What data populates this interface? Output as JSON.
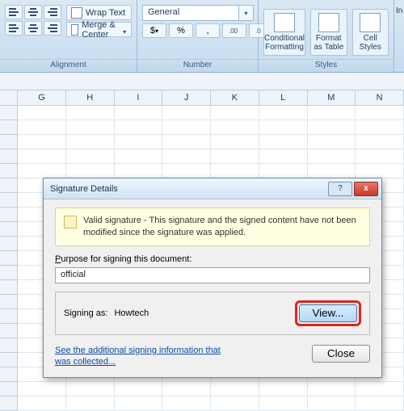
{
  "ribbon": {
    "alignment": {
      "title": "Alignment",
      "wrap_text": "Wrap Text",
      "merge_center": "Merge & Center"
    },
    "number": {
      "title": "Number",
      "format_selected": "General",
      "percent": "%",
      "currency": "$",
      "comma": ","
    },
    "styles": {
      "title": "Styles",
      "conditional": "Conditional Formatting",
      "format_as_table": "Format as Table",
      "cell_styles": "Cell Styles"
    },
    "insert_partial": "In"
  },
  "columns": [
    "G",
    "H",
    "I",
    "J",
    "K",
    "L",
    "M",
    "N"
  ],
  "dialog": {
    "title": "Signature Details",
    "valid_msg": "Valid signature - This signature and the signed content have not been modified since the signature was applied.",
    "purpose_label_pre": "P",
    "purpose_label_rest": "urpose for signing this document:",
    "purpose_value": "official",
    "signing_as_label": "Signing as:",
    "signing_as_value": "Howtech",
    "view_btn": "View...",
    "link_text": "See the additional signing information that was collected...",
    "close_btn": "Close",
    "help_char": "?",
    "close_char": "x"
  }
}
